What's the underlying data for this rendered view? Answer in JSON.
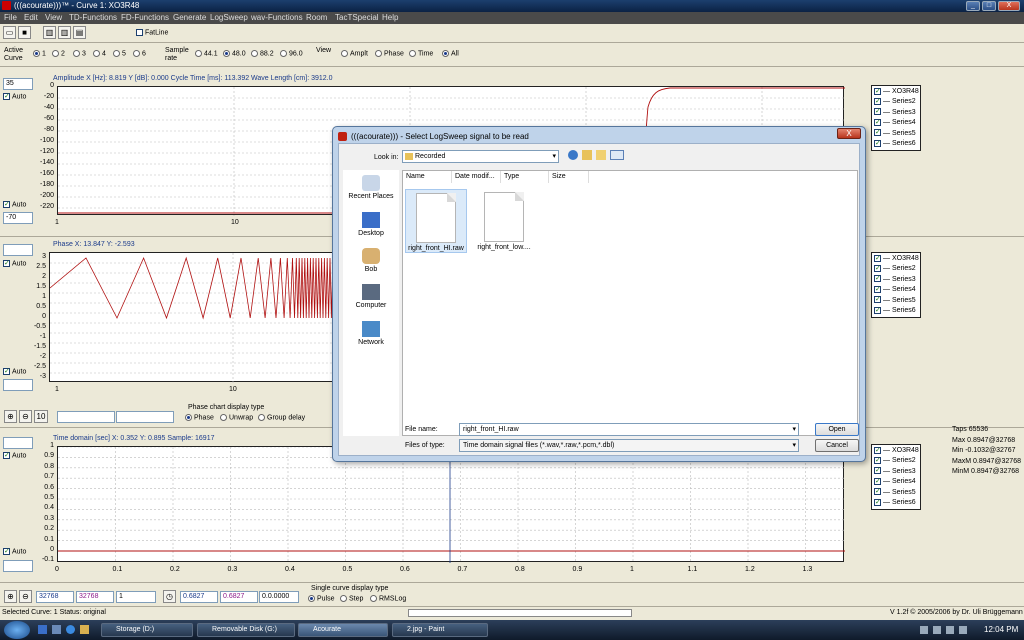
{
  "window": {
    "title": "(((acourate)))™ - Curve 1: XO3R48",
    "minimize": "_",
    "maximize": "□",
    "close": "X"
  },
  "menu": [
    "File",
    "Edit",
    "View",
    "TD-Functions",
    "FD-Functions",
    "Generate",
    "LogSweep",
    "wav-Functions",
    "Room",
    "TacTSpecial",
    "Help"
  ],
  "toolbar": {
    "fatline": "FatLine"
  },
  "options": {
    "active_curve_label": "Active Curve",
    "active_curves": [
      "1",
      "2",
      "3",
      "4",
      "5",
      "6"
    ],
    "sample_rate_label": "Sample rate",
    "sample_rates": [
      "44.1",
      "48.0",
      "88.2",
      "96.0"
    ],
    "view_label": "View",
    "views": [
      "Amplt",
      "Phase",
      "Time",
      "All"
    ]
  },
  "amplitude": {
    "top_box": "35",
    "bottom_box": "-70",
    "auto1": "Auto",
    "auto2": "Auto",
    "header": "Amplitude   X [Hz]: 8.819   Y [dB]: 0.000   Cycle Time [ms]: 113.392   Wave Length [cm]: 3912.0",
    "yticks": [
      "0",
      "-20",
      "-40",
      "-60",
      "-80",
      "-100",
      "-120",
      "-140",
      "-160",
      "-180",
      "-200",
      "-220"
    ],
    "xticks": [
      "1",
      "10"
    ]
  },
  "phase": {
    "auto1": "Auto",
    "auto2": "Auto",
    "header": "Phase   X: 13.847   Y: -2.593",
    "yticks": [
      "3",
      "2.5",
      "2",
      "1.5",
      "1",
      "0.5",
      "0",
      "-0.5",
      "-1",
      "-1.5",
      "-2",
      "-2.5",
      "-3"
    ],
    "xticks": [
      "1",
      "10"
    ],
    "display_type_label": "Phase chart display type",
    "display_types": [
      "Phase",
      "Unwrap",
      "Group delay"
    ]
  },
  "zoom_row": {
    "ten": "10"
  },
  "time": {
    "auto1": "Auto",
    "auto2": "Auto",
    "header": "Time domain [sec]   X: 0.352   Y: 0.895   Sample: 16917",
    "yticks": [
      "1",
      "0.9",
      "0.8",
      "0.7",
      "0.6",
      "0.5",
      "0.4",
      "0.3",
      "0.2",
      "0.1",
      "0",
      "-0.1"
    ],
    "xticks": [
      "0",
      "0.1",
      "0.2",
      "0.3",
      "0.4",
      "0.5",
      "0.6",
      "0.7",
      "0.8",
      "0.9",
      "1",
      "1.1",
      "1.2",
      "1.3"
    ],
    "stats": [
      "Taps 65536",
      "Max 0.8947@32768",
      "Min -0.1032@32767",
      "MaxM 0.8947@32768",
      "MinM 0.8947@32768"
    ]
  },
  "legend": [
    "XO3R48",
    "Series2",
    "Series3",
    "Series4",
    "Series5",
    "Series6"
  ],
  "bottom_row": {
    "v1": "32768",
    "v2": "32768",
    "v3": "1",
    "v4": "0.6827",
    "v5": "0.6827",
    "v6": "0.0.0000",
    "single_label": "Single curve display type",
    "types": [
      "Pulse",
      "Step",
      "RMSLog"
    ]
  },
  "status": {
    "left": "Selected Curve: 1   Status: original",
    "right": "V 1.2f © 2005/2006 by Dr. Uli Brüggemann"
  },
  "dialog": {
    "title": "(((acourate))) - Select LogSweep signal to be read",
    "close": "X",
    "look_in_label": "Look in:",
    "look_in_value": "Recorded",
    "places": [
      "Recent Places",
      "Desktop",
      "Bob",
      "Computer",
      "Network"
    ],
    "columns": [
      "Name",
      "Date modif...",
      "Type",
      "Size"
    ],
    "files": [
      "right_front_HI.raw",
      "right_front_low...."
    ],
    "file_name_label": "File name:",
    "file_name_value": "right_front_HI.raw",
    "file_type_label": "Files of type:",
    "file_type_value": "Time domain signal files (*.wav,*.raw,*.pcm,*.dbl)",
    "open": "Open",
    "cancel": "Cancel"
  },
  "taskbar": {
    "tasks": [
      "Storage (D:)",
      "Removable Disk (G:)",
      "Acourate",
      "2.jpg - Paint"
    ],
    "clock": "12:04 PM"
  }
}
